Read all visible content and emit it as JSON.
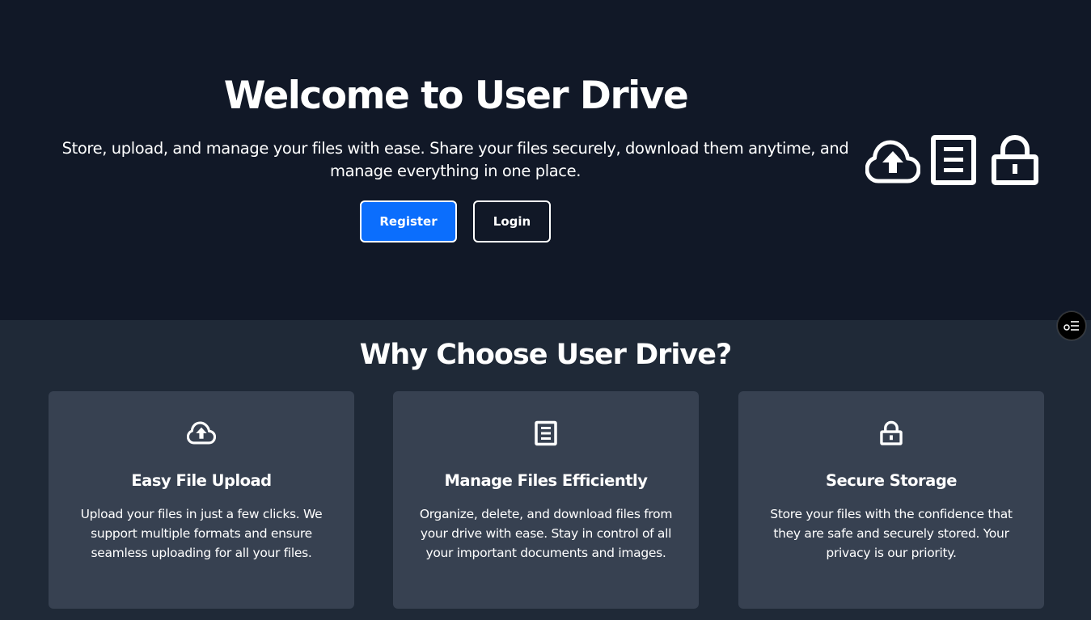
{
  "hero": {
    "title": "Welcome to User Drive",
    "subtitle": "Store, upload, and manage your files with ease. Share your files securely, download them anytime, and manage everything in one place.",
    "register_label": "Register",
    "login_label": "Login",
    "icons": [
      "cloud-upload-icon",
      "document-icon",
      "lock-icon"
    ]
  },
  "features": {
    "title": "Why Choose User Drive?",
    "cards": [
      {
        "icon": "cloud-upload-icon",
        "title": "Easy File Upload",
        "description": "Upload your files in just a few clicks. We support multiple formats and ensure seamless uploading for all your files."
      },
      {
        "icon": "document-icon",
        "title": "Manage Files Efficiently",
        "description": "Organize, delete, and download files from your drive with ease. Stay in control of all your important documents and images."
      },
      {
        "icon": "lock-icon",
        "title": "Secure Storage",
        "description": "Store your files with the confidence that they are safe and securely stored. Your privacy is our priority."
      }
    ]
  },
  "floating_button": {
    "icon": "tasks-list-icon"
  },
  "colors": {
    "hero_bg": "#111827",
    "section_bg": "#1f2937",
    "card_bg": "#374151",
    "primary": "#0b6efd",
    "text": "#ffffff"
  }
}
